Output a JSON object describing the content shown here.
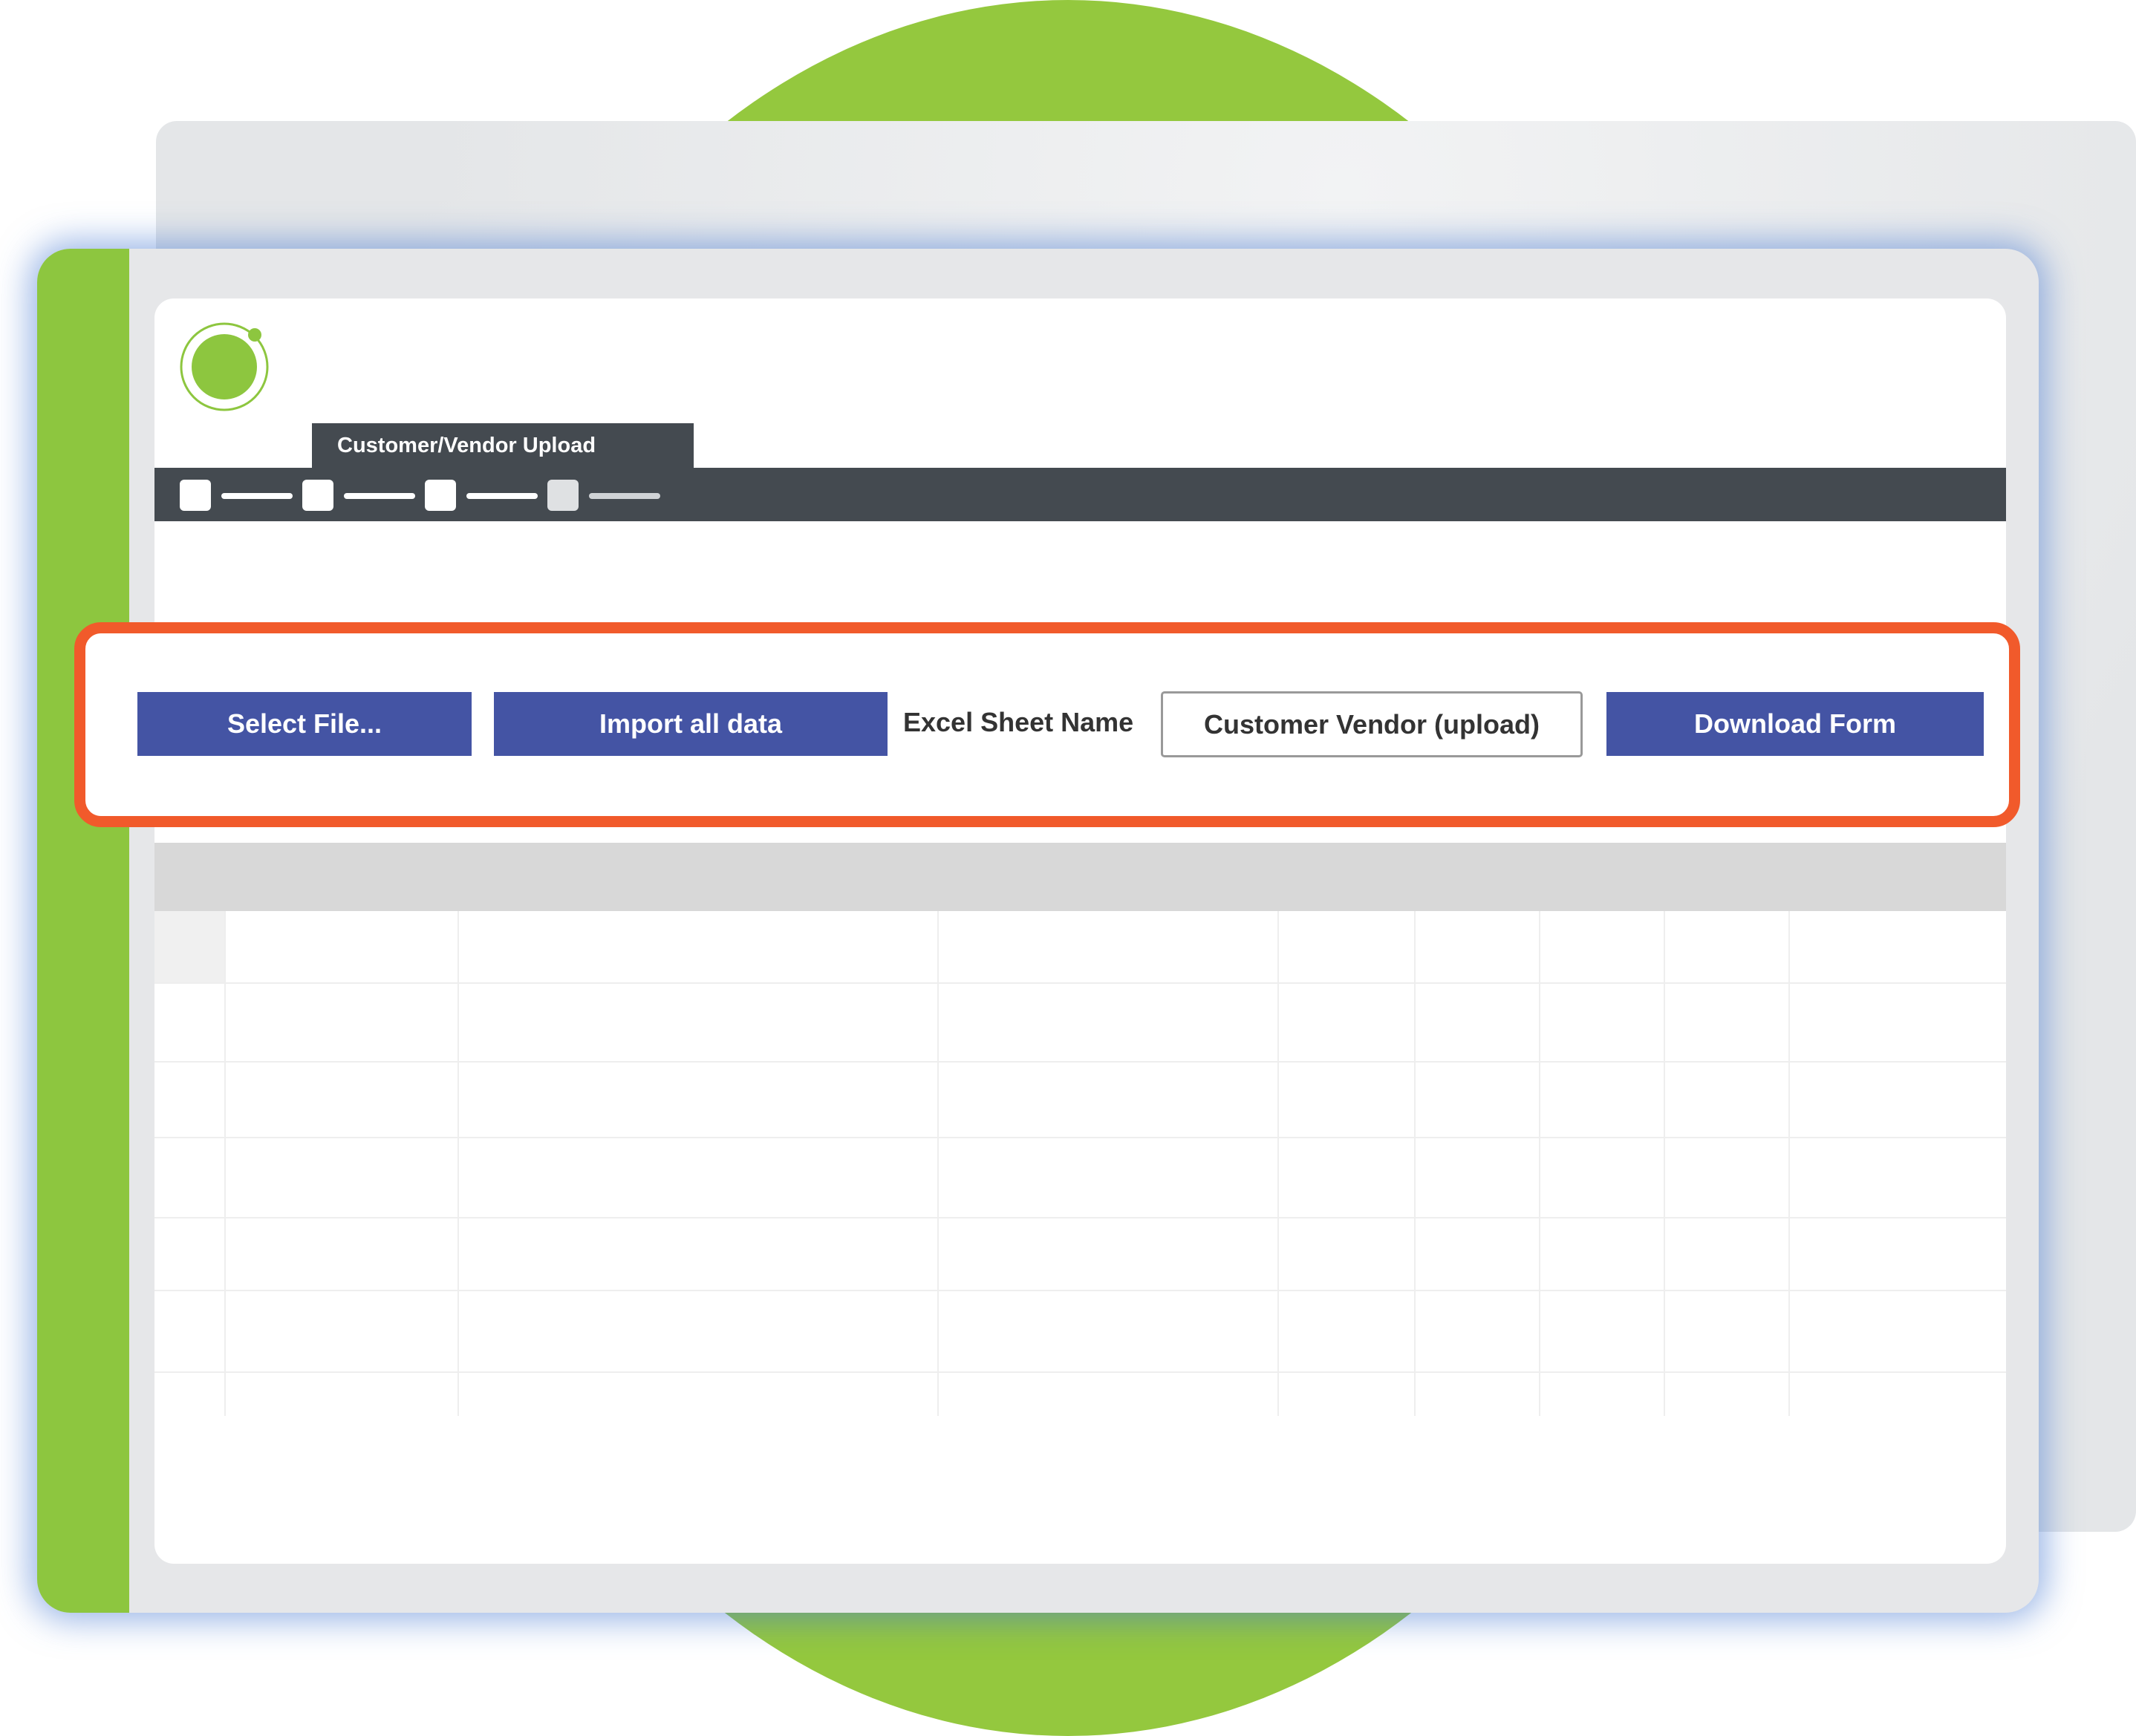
{
  "app": {
    "tab_title": "Customer/Vendor Upload"
  },
  "toolbar": {
    "steps": [
      "step-1",
      "step-2",
      "step-3",
      "step-4"
    ]
  },
  "actions": {
    "select_file_label": "Select File...",
    "import_label": "Import all data",
    "sheet_name_label": "Excel Sheet Name",
    "sheet_name_value": "Customer Vendor (upload)",
    "download_label": "Download Form"
  },
  "colors": {
    "brand_green": "#8dc63f",
    "button_blue": "#4454a4",
    "toolbar_dark": "#444a50",
    "highlight_orange": "#f15a2b"
  }
}
